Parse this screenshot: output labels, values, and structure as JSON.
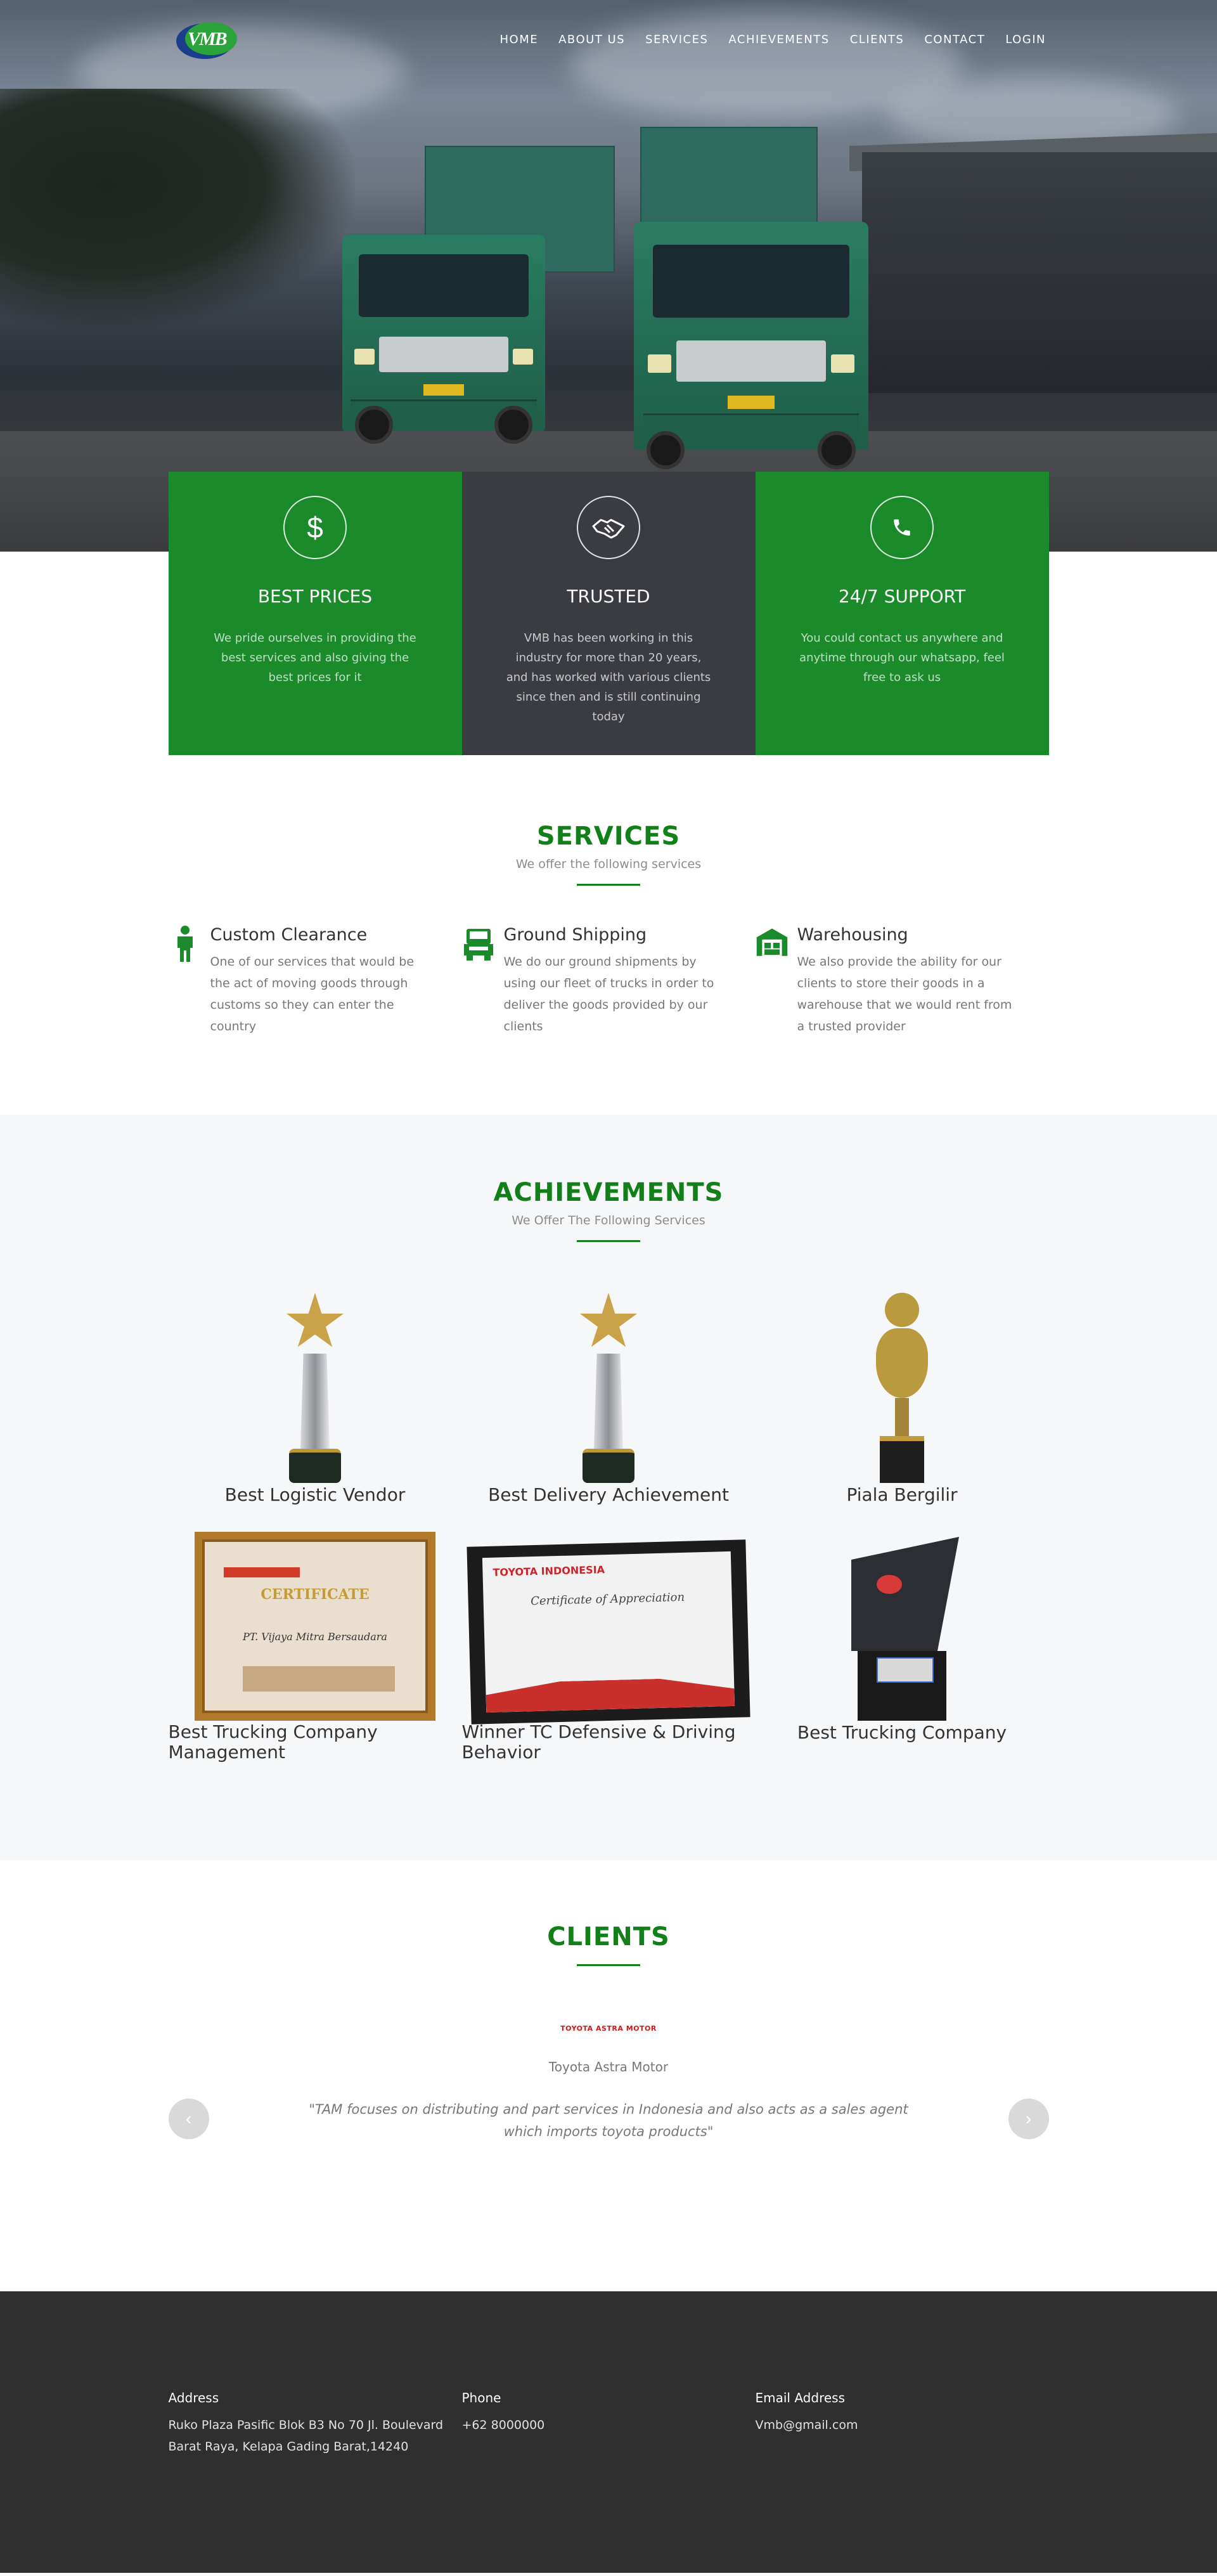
{
  "nav": {
    "items": [
      "HOME",
      "ABOUT US",
      "SERVICES",
      "ACHIEVEMENTS",
      "CLIENTS",
      "CONTACT",
      "LOGIN"
    ]
  },
  "logo": {
    "text": "VMB"
  },
  "features": [
    {
      "title": "BEST PRICES",
      "icon": "dollar-icon",
      "text": "We pride ourselves in providing the best services and also giving the best prices for it",
      "color": "#1a8a2b"
    },
    {
      "title": "TRUSTED",
      "icon": "handshake-icon",
      "text": "VMB has been working in this industry for more than 20 years, and has worked with various clients since then and is still continuing today",
      "color": "#3a3c42"
    },
    {
      "title": "24/7 SUPPORT",
      "icon": "phone-icon",
      "text": "You could contact us anywhere and anytime through our whatsapp, feel free to ask us",
      "color": "#1a8a2b"
    }
  ],
  "services": {
    "title": "SERVICES",
    "subtitle": "We offer the following services",
    "items": [
      {
        "title": "Custom Clearance",
        "icon": "person-icon",
        "text": "One of our services that would be the act of moving goods through customs so they can enter the country"
      },
      {
        "title": "Ground Shipping",
        "icon": "truck-icon",
        "text": "We do our ground shipments by using our fleet of trucks in order to deliver the goods provided by our clients"
      },
      {
        "title": "Warehousing",
        "icon": "warehouse-icon",
        "text": "We also provide the ability for our clients to store their goods in a warehouse that we would rent from a trusted provider"
      }
    ]
  },
  "achievements": {
    "title": "ACHIEVEMENTS",
    "subtitle": "We Offer The Following Services",
    "items": [
      {
        "caption": "Best Logistic Vendor"
      },
      {
        "caption": "Best Delivery Achievement"
      },
      {
        "caption": "Piala Bergilir"
      },
      {
        "caption": "Best Trucking Company Management"
      },
      {
        "caption": "Winner TC Defensive & Driving Behavior"
      },
      {
        "caption": "Best Trucking Company"
      }
    ],
    "cert1": {
      "heading": "CERTIFICATE",
      "name": "PT. Vijaya Mitra Bersaudara"
    },
    "cert2": {
      "brand": "TOYOTA INDONESIA",
      "heading": "Certificate of Appreciation"
    }
  },
  "clients": {
    "title": "CLIENTS",
    "logo_text": "TOYOTA ASTRA MOTOR",
    "name": "Toyota Astra Motor",
    "quote": "\"TAM focuses on distributing and part services in Indonesia and also acts as a sales agent which imports toyota products\"",
    "prev": "‹",
    "next": "›"
  },
  "footer": {
    "address_label": "Address",
    "address": "Ruko Plaza Pasific Blok B3 No 70 Jl. Boulevard Barat Raya, Kelapa Gading Barat,14240",
    "phone_label": "Phone",
    "phone": "+62 8000000",
    "email_label": "Email Address",
    "email": "Vmb@gmail.com"
  }
}
